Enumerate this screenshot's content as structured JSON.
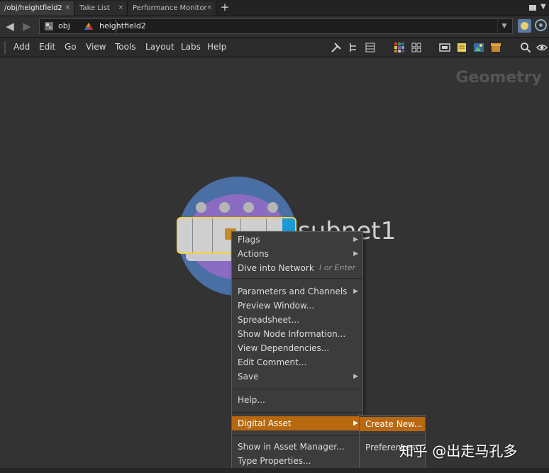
{
  "tabs": [
    {
      "label": "/obj/heightfield2",
      "close": "×"
    },
    {
      "label": "Take List",
      "close": "×"
    },
    {
      "label": "Performance Monitor",
      "close": "×"
    }
  ],
  "tab_add": "+",
  "path": {
    "segments": [
      "obj",
      "heightfield2"
    ],
    "back_icon": "back-arrow-icon",
    "forward_icon": "forward-arrow-icon"
  },
  "menubar": {
    "items": [
      "Add",
      "Edit",
      "Go",
      "View",
      "Tools",
      "Layout",
      "Labs",
      "Help"
    ]
  },
  "network": {
    "context_label": "Geometry",
    "node_name": "subnet1"
  },
  "context_menu": {
    "items": [
      {
        "label": "Flags",
        "submenu": true
      },
      {
        "label": "Actions",
        "submenu": true
      },
      {
        "label": "Dive into Network",
        "shortcut": "I or Enter"
      },
      {
        "label": "Parameters and Channels",
        "submenu": true
      },
      {
        "label": "Preview Window..."
      },
      {
        "label": "Spreadsheet..."
      },
      {
        "label": "Show Node Information..."
      },
      {
        "label": "View Dependencies..."
      },
      {
        "label": "Edit Comment..."
      },
      {
        "label": "Save",
        "submenu": true
      },
      {
        "label": "Help..."
      },
      {
        "label": "Digital Asset",
        "submenu": true,
        "highlighted": true
      },
      {
        "label": "Show in Asset Manager..."
      },
      {
        "label": "Type Properties..."
      }
    ],
    "submenu_arrow": "▶"
  },
  "submenu": {
    "items": [
      "Create New...",
      "Preferences"
    ]
  },
  "watermark": "知乎 @出走马孔多",
  "colors": {
    "highlight": "#b8680f",
    "node_ring": "#4a6fa5",
    "node_inner": "#8a6cc2",
    "node_selected_border": "#f2d13a"
  }
}
